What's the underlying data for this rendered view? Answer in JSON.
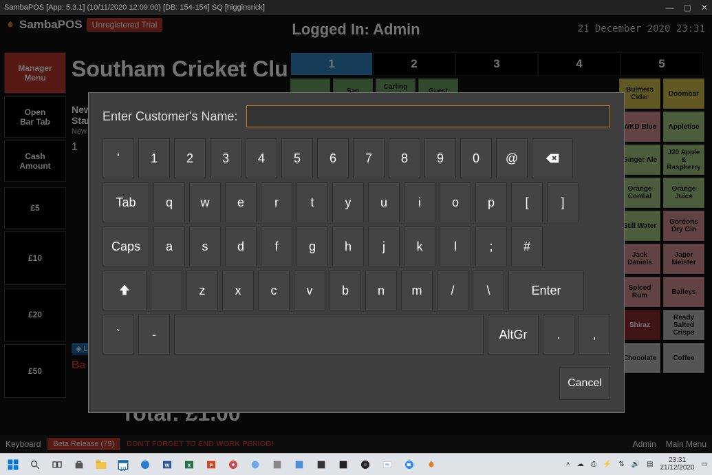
{
  "window": {
    "title": "SambaPOS [App: 5.3.1] (10/11/2020 12:09:00) [DB: 154-154] SQ [higginsrick]",
    "min": "—",
    "max": "▢",
    "close": "✕"
  },
  "brand": {
    "name": "SambaPOS",
    "trial": "Unregistered Trial"
  },
  "header": {
    "logged_in": "Logged In: Admin",
    "date": "21 December 2020 23:31"
  },
  "sidebar": {
    "manager": "Manager\nMenu",
    "open_tab": "Open\nBar Tab",
    "cash": "Cash\nAmount",
    "d5": "£5",
    "d10": "£10",
    "d20": "£20",
    "d50": "£50"
  },
  "center": {
    "venue": "Southam Cricket Club",
    "new_label": "New\nStart",
    "new_note": "New",
    "qty": "1",
    "chip_label": "◈ L",
    "bartab": "Ba",
    "total": "Total: £1.00"
  },
  "tabs": [
    "1",
    "2",
    "3",
    "4",
    "5"
  ],
  "products_top": [
    {
      "label": "",
      "cls": "c-green"
    },
    {
      "label": "San",
      "cls": "c-green"
    },
    {
      "label": "Carling Dark",
      "cls": "c-green"
    },
    {
      "label": "Guest",
      "cls": "c-green"
    }
  ],
  "products_right": [
    {
      "label": "Bulmers Cider",
      "cls": "c-yellow"
    },
    {
      "label": "Doombar",
      "cls": "c-yellow"
    },
    {
      "label": "WKD Blue",
      "cls": "c-pink"
    },
    {
      "label": "Appletise",
      "cls": "c-lime"
    },
    {
      "label": "Ginger Ale",
      "cls": "c-lime"
    },
    {
      "label": "J20 Apple & Raspberry",
      "cls": "c-lime"
    },
    {
      "label": "Orange Cordial",
      "cls": "c-lime"
    },
    {
      "label": "Orange Juice",
      "cls": "c-lime"
    },
    {
      "label": "Still Water",
      "cls": "c-lime"
    },
    {
      "label": "Gordons Dry Gin",
      "cls": "c-pink"
    },
    {
      "label": "Jack Daniels",
      "cls": "c-pink"
    },
    {
      "label": "Jager Meister",
      "cls": "c-pink"
    },
    {
      "label": "Spiced Rum",
      "cls": "c-pink"
    },
    {
      "label": "Baileys",
      "cls": "c-pink"
    },
    {
      "label": "Shiraz",
      "cls": "c-dred"
    },
    {
      "label": "Ready Salted Crisps",
      "cls": "c-grey"
    },
    {
      "label": "Chocolate",
      "cls": "c-grey"
    },
    {
      "label": "Coffee",
      "cls": "c-grey"
    }
  ],
  "modal": {
    "prompt": "Enter Customer's Name:",
    "value": "",
    "rows": [
      [
        "'",
        "1",
        "2",
        "3",
        "4",
        "5",
        "6",
        "7",
        "8",
        "9",
        "0",
        "@"
      ],
      [
        "Tab",
        "q",
        "w",
        "e",
        "r",
        "t",
        "y",
        "u",
        "i",
        "o",
        "p",
        "[",
        "]"
      ],
      [
        "Caps",
        "a",
        "s",
        "d",
        "f",
        "g",
        "h",
        "j",
        "k",
        "l",
        ";",
        "#"
      ],
      [
        "⇧",
        "",
        "z",
        "x",
        "c",
        "v",
        "b",
        "n",
        "m",
        "/",
        "\\",
        "Enter"
      ],
      [
        "`",
        "-",
        "SPACE",
        "AltGr",
        ".",
        ","
      ]
    ],
    "cancel": "Cancel"
  },
  "footer": {
    "keyboard": "Keyboard",
    "beta": "Beta Release (79)",
    "warning": "DON'T FORGET TO END WORK PERIOD!",
    "user": "Admin",
    "menu": "Main Menu"
  },
  "taskbar": {
    "time": "23:31",
    "date": "21/12/2020",
    "day_badge": "19"
  }
}
